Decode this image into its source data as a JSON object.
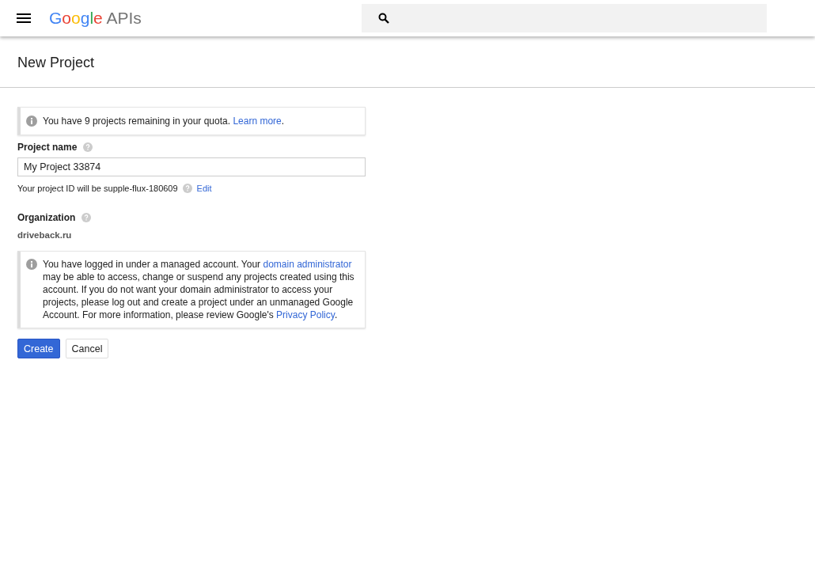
{
  "header": {
    "logo": {
      "brand": "Google",
      "product": "APIs"
    }
  },
  "page_title": "New Project",
  "quota_notice": {
    "segments": [
      {
        "text": "You have 9 projects remaining in your quota. ",
        "link": false
      },
      {
        "text": "Learn more",
        "link": true
      },
      {
        "text": ".",
        "link": false
      }
    ]
  },
  "project_name": {
    "label": "Project name",
    "value": "My Project 33874"
  },
  "project_id": {
    "text": "Your project ID will be supple-flux-180609",
    "edit": "Edit"
  },
  "organization": {
    "label": "Organization",
    "value": "driveback.ru"
  },
  "managed_notice": {
    "segments": [
      {
        "text": "You have logged in under a managed account. Your ",
        "link": false
      },
      {
        "text": "domain administrator",
        "link": true
      },
      {
        "text": " may be able to access, change or suspend any projects created using this account. If you do not want your domain administrator to access your projects, please log out and create a project under an unmanaged Google Account. For more information, please review Google's ",
        "link": false
      },
      {
        "text": "Privacy Policy",
        "link": true
      },
      {
        "text": ".",
        "link": false
      }
    ]
  },
  "buttons": [
    {
      "label": "Create",
      "kind": "primary"
    },
    {
      "label": "Cancel",
      "kind": "secondary"
    }
  ]
}
